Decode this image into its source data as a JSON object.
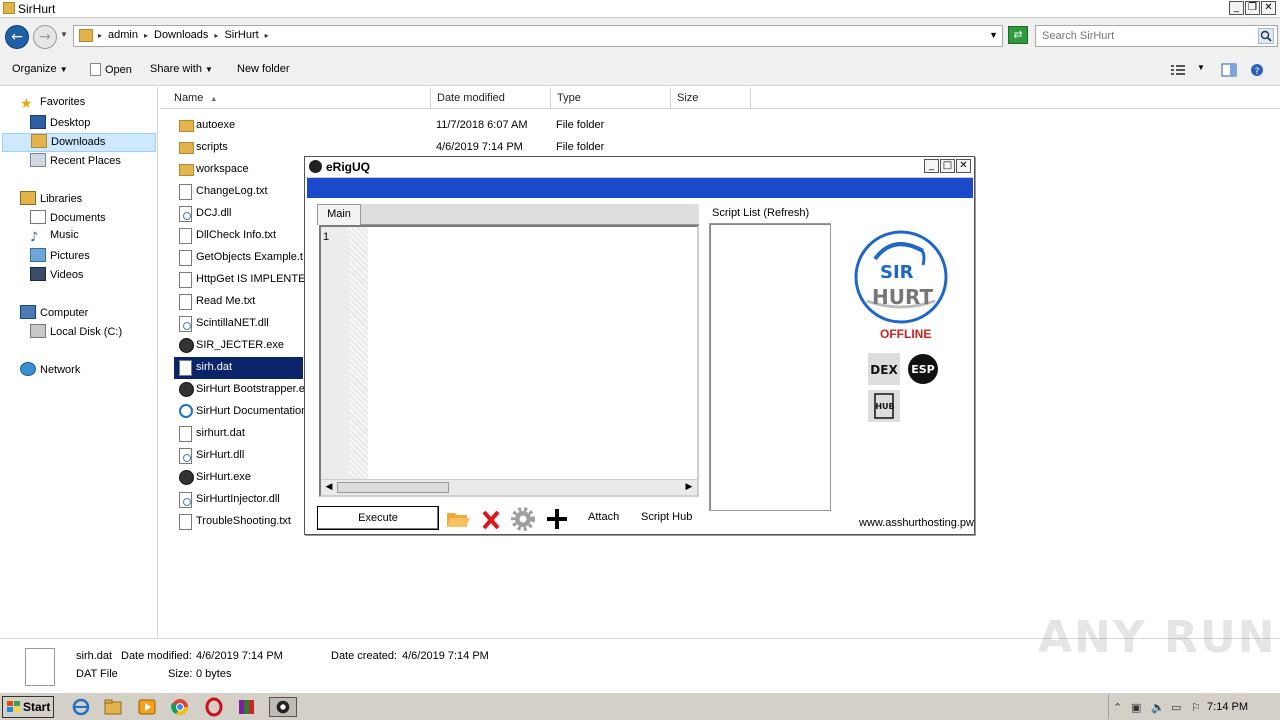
{
  "explorer": {
    "title": "SirHurt",
    "breadcrumb": [
      "admin",
      "Downloads",
      "SirHurt"
    ],
    "search_placeholder": "Search SirHurt",
    "toolbar": {
      "organize": "Organize",
      "open": "Open",
      "share_with": "Share with",
      "new_folder": "New folder"
    },
    "nav": {
      "favorites": "Favorites",
      "desktop": "Desktop",
      "downloads": "Downloads",
      "recent_places": "Recent Places",
      "libraries": "Libraries",
      "documents": "Documents",
      "music": "Music",
      "pictures": "Pictures",
      "videos": "Videos",
      "computer": "Computer",
      "local_disk": "Local Disk (C:)",
      "network": "Network"
    },
    "columns": {
      "name": "Name",
      "date_modified": "Date modified",
      "type": "Type",
      "size": "Size"
    },
    "files": [
      {
        "name": "autoexe",
        "date": "11/7/2018 6:07 AM",
        "type": "File folder",
        "icon": "folder-icon"
      },
      {
        "name": "scripts",
        "date": "4/6/2019 7:14 PM",
        "type": "File folder",
        "icon": "folder-icon"
      },
      {
        "name": "workspace",
        "date": "",
        "type": "",
        "icon": "folder-icon"
      },
      {
        "name": "ChangeLog.txt",
        "date": "",
        "type": "",
        "icon": "text-file-icon"
      },
      {
        "name": "DCJ.dll",
        "date": "",
        "type": "",
        "icon": "dll-file-icon"
      },
      {
        "name": "DllCheck Info.txt",
        "date": "",
        "type": "",
        "icon": "text-file-icon"
      },
      {
        "name": "GetObjects Example.t",
        "date": "",
        "type": "",
        "icon": "text-file-icon"
      },
      {
        "name": "HttpGet IS IMPLENTED",
        "date": "",
        "type": "",
        "icon": "text-file-icon"
      },
      {
        "name": "Read Me.txt",
        "date": "",
        "type": "",
        "icon": "text-file-icon"
      },
      {
        "name": "ScintillaNET.dll",
        "date": "",
        "type": "",
        "icon": "dll-file-icon"
      },
      {
        "name": "SIR_JECTER.exe",
        "date": "",
        "type": "",
        "icon": "exe-file-icon"
      },
      {
        "name": "sirh.dat",
        "date": "",
        "type": "",
        "icon": "dat-file-icon",
        "selected": true
      },
      {
        "name": "SirHurt Bootstrapper.e",
        "date": "",
        "type": "",
        "icon": "exe-file-icon"
      },
      {
        "name": "SirHurt Documentation",
        "date": "",
        "type": "",
        "icon": "html-file-icon"
      },
      {
        "name": "sirhurt.dat",
        "date": "",
        "type": "",
        "icon": "dat-file-icon"
      },
      {
        "name": "SirHurt.dll",
        "date": "",
        "type": "",
        "icon": "dll-file-icon"
      },
      {
        "name": "SirHurt.exe",
        "date": "",
        "type": "",
        "icon": "exe-file-icon"
      },
      {
        "name": "SirHurtInjector.dll",
        "date": "",
        "type": "",
        "icon": "dll-file-icon"
      },
      {
        "name": "TroubleShooting.txt",
        "date": "",
        "type": "",
        "icon": "text-file-icon"
      }
    ],
    "details": {
      "filename": "sirh.dat",
      "date_modified_label": "Date modified:",
      "date_modified": "4/6/2019 7:14 PM",
      "date_created_label": "Date created:",
      "date_created": "4/6/2019 7:14 PM",
      "filetype": "DAT File",
      "size_label": "Size:",
      "size": "0 bytes"
    }
  },
  "dialog": {
    "title": "eRigUQ",
    "band_color": "#1a49c9",
    "tab": "Main",
    "line_number": "1",
    "script_list_label": "Script List (Refresh)",
    "execute": "Execute",
    "attach": "Attach",
    "script_hub": "Script Hub",
    "status": "OFFLINE",
    "status_color": "#cc2222",
    "website": "www.asshurthosting.pw",
    "logo_text_top": "SIR",
    "logo_text_bottom": "HURT",
    "badges": {
      "dex": "DEX",
      "esp": "ESP",
      "hub": "HUB"
    }
  },
  "taskbar": {
    "start": "Start",
    "clock": "7:14 PM"
  },
  "watermark": "ANY RUN"
}
